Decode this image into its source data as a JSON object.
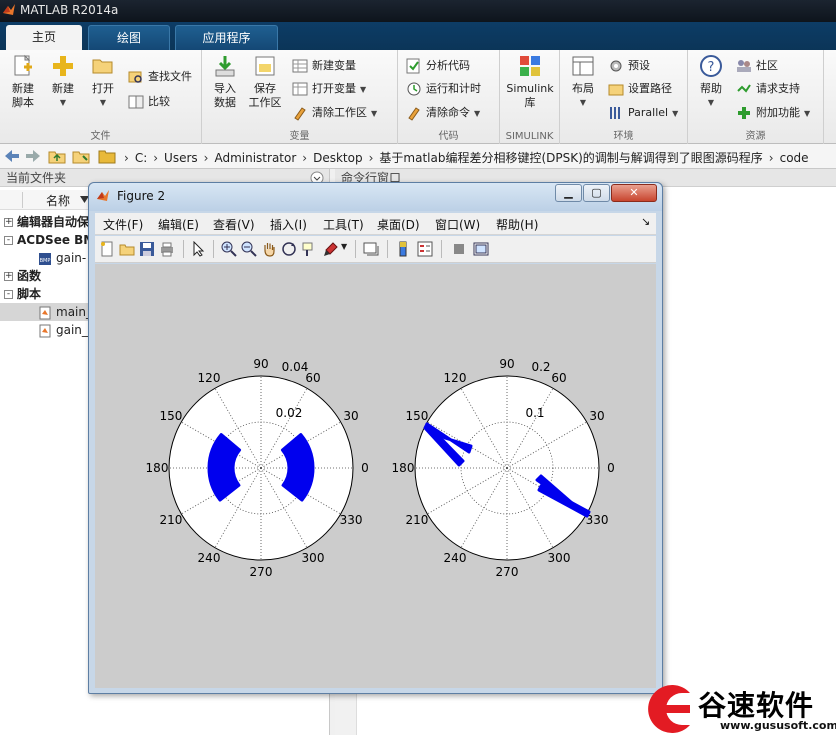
{
  "window": {
    "title": "MATLAB R2014a"
  },
  "tabs": [
    {
      "label": "主页",
      "active": true
    },
    {
      "label": "绘图",
      "active": false
    },
    {
      "label": "应用程序",
      "active": false
    }
  ],
  "ribbon": {
    "file": {
      "section_label": "文件",
      "new_script": "新建\n脚本",
      "new": "新建",
      "open": "打开",
      "find_files": "查找文件",
      "compare": "比较"
    },
    "variable": {
      "section_label": "变量",
      "import": "导入\n数据",
      "save_ws": "保存\n工作区",
      "new_var": "新建变量",
      "open_var": "打开变量",
      "clear_ws": "清除工作区"
    },
    "code": {
      "section_label": "代码",
      "analyze": "分析代码",
      "run_time": "运行和计时",
      "clear_cmd": "清除命令"
    },
    "simulink": {
      "section_label": "SIMULINK",
      "library": "Simulink\n库"
    },
    "environment": {
      "section_label": "环境",
      "layout": "布局",
      "preferences": "预设",
      "set_path": "设置路径",
      "parallel": "Parallel"
    },
    "resources": {
      "section_label": "资源",
      "help": "帮助",
      "community": "社区",
      "support": "请求支持",
      "addons": "附加功能"
    }
  },
  "address": {
    "crumbs": [
      "C:",
      "Users",
      "Administrator",
      "Desktop",
      "基于matlab编程差分相移键控(DPSK)的调制与解调得到了眼图源码程序",
      "code"
    ]
  },
  "left_panel": {
    "title": "当前文件夹",
    "col_name": "名称",
    "rows": [
      {
        "label": "编辑器自动保",
        "type": "group",
        "expander": "+"
      },
      {
        "label": "ACDSee BM",
        "type": "group",
        "expander": "-"
      },
      {
        "label": "gain-",
        "type": "file",
        "icon": "bmp-icon"
      },
      {
        "label": "函数",
        "type": "group",
        "expander": "+"
      },
      {
        "label": "脚本",
        "type": "group",
        "expander": "-"
      },
      {
        "label": "main_",
        "type": "file",
        "icon": "m-file-icon",
        "selected": true
      },
      {
        "label": "gain_",
        "type": "file",
        "icon": "m-file-icon"
      }
    ]
  },
  "command_window": {
    "title": "命令行窗口"
  },
  "figure": {
    "title": "Figure 2",
    "menus": [
      "文件(F)",
      "编辑(E)",
      "查看(V)",
      "插入(I)",
      "工具(T)",
      "桌面(D)",
      "窗口(W)",
      "帮助(H)"
    ],
    "polar_plots": [
      {
        "rmax": 0.04,
        "rings": [
          "0.02",
          "0.04"
        ],
        "angles": [
          "0",
          "30",
          "60",
          "90",
          "120",
          "150",
          "180",
          "210",
          "240",
          "270",
          "300",
          "330"
        ]
      },
      {
        "rmax": 0.2,
        "rings": [
          "0.1",
          "0.2"
        ],
        "angles": [
          "0",
          "30",
          "60",
          "90",
          "120",
          "150",
          "180",
          "210",
          "240",
          "270",
          "300",
          "330"
        ]
      }
    ],
    "series_color": "#0000ee"
  },
  "watermark": {
    "text": "谷速软件",
    "url": "www.gususoft.com",
    "color": "#e31b23"
  }
}
